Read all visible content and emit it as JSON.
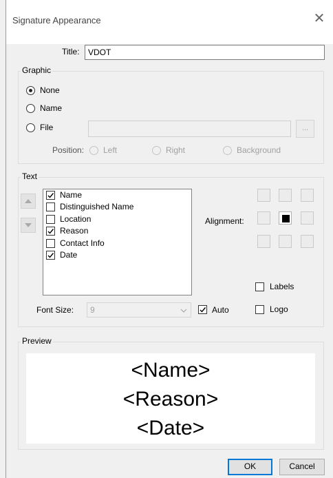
{
  "dialog": {
    "title": "Signature Appearance"
  },
  "title_field": {
    "label": "Title:",
    "value": "VDOT"
  },
  "graphic": {
    "caption": "Graphic",
    "options": [
      "None",
      "Name",
      "File"
    ],
    "selected": "None",
    "browse_label": "...",
    "position_label": "Position:",
    "positions": [
      "Left",
      "Right",
      "Background"
    ]
  },
  "text": {
    "caption": "Text",
    "items": [
      {
        "label": "Name",
        "checked": true
      },
      {
        "label": "Distinguished Name",
        "checked": false
      },
      {
        "label": "Location",
        "checked": false
      },
      {
        "label": "Reason",
        "checked": true
      },
      {
        "label": "Contact Info",
        "checked": false
      },
      {
        "label": "Date",
        "checked": true
      }
    ],
    "alignment_label": "Alignment:",
    "alignment_selected": "middle-center",
    "labels_option": "Labels",
    "logo_option": "Logo",
    "font_size_label": "Font Size:",
    "font_size_value": "9",
    "auto_label": "Auto",
    "auto_checked": true
  },
  "preview": {
    "caption": "Preview",
    "lines": [
      "<Name>",
      "<Reason>",
      "<Date>"
    ]
  },
  "buttons": {
    "ok": "OK",
    "cancel": "Cancel"
  }
}
